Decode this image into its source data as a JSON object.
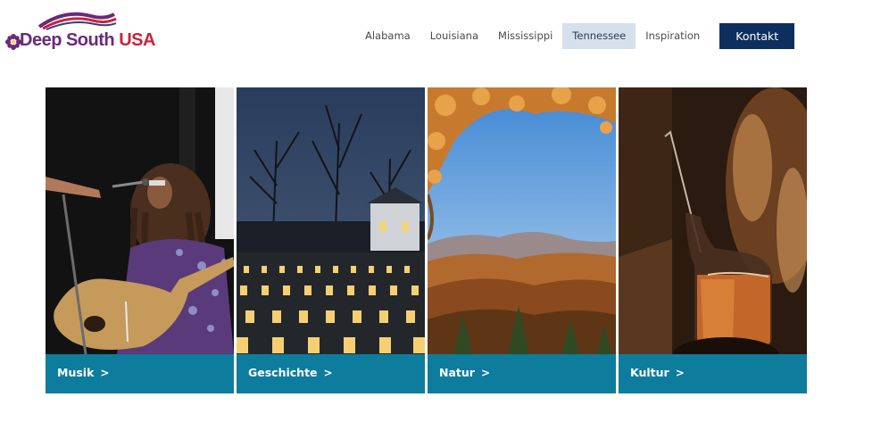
{
  "brand": {
    "name_part1": "Deep South",
    "name_part2": "USA",
    "colors": {
      "purple": "#6a2a78",
      "red": "#c8243a"
    }
  },
  "nav": {
    "items": [
      {
        "label": "Alabama",
        "active": false
      },
      {
        "label": "Louisiana",
        "active": false
      },
      {
        "label": "Mississippi",
        "active": false
      },
      {
        "label": "Tennessee",
        "active": true
      },
      {
        "label": "Inspiration",
        "active": false
      }
    ],
    "contact_label": "Kontakt",
    "active_bg": "#d5e0ea",
    "contact_bg": "#0e2f5e"
  },
  "tiles": [
    {
      "label": "Musik",
      "chevron": ">",
      "image": "musician-with-guitar"
    },
    {
      "label": "Geschichte",
      "chevron": ">",
      "image": "candle-luminaries-at-night"
    },
    {
      "label": "Natur",
      "chevron": ">",
      "image": "autumn-mountains"
    },
    {
      "label": "Kultur",
      "chevron": ">",
      "image": "whiskey-pour"
    }
  ],
  "tile_bar_color": "#0e7c9c"
}
